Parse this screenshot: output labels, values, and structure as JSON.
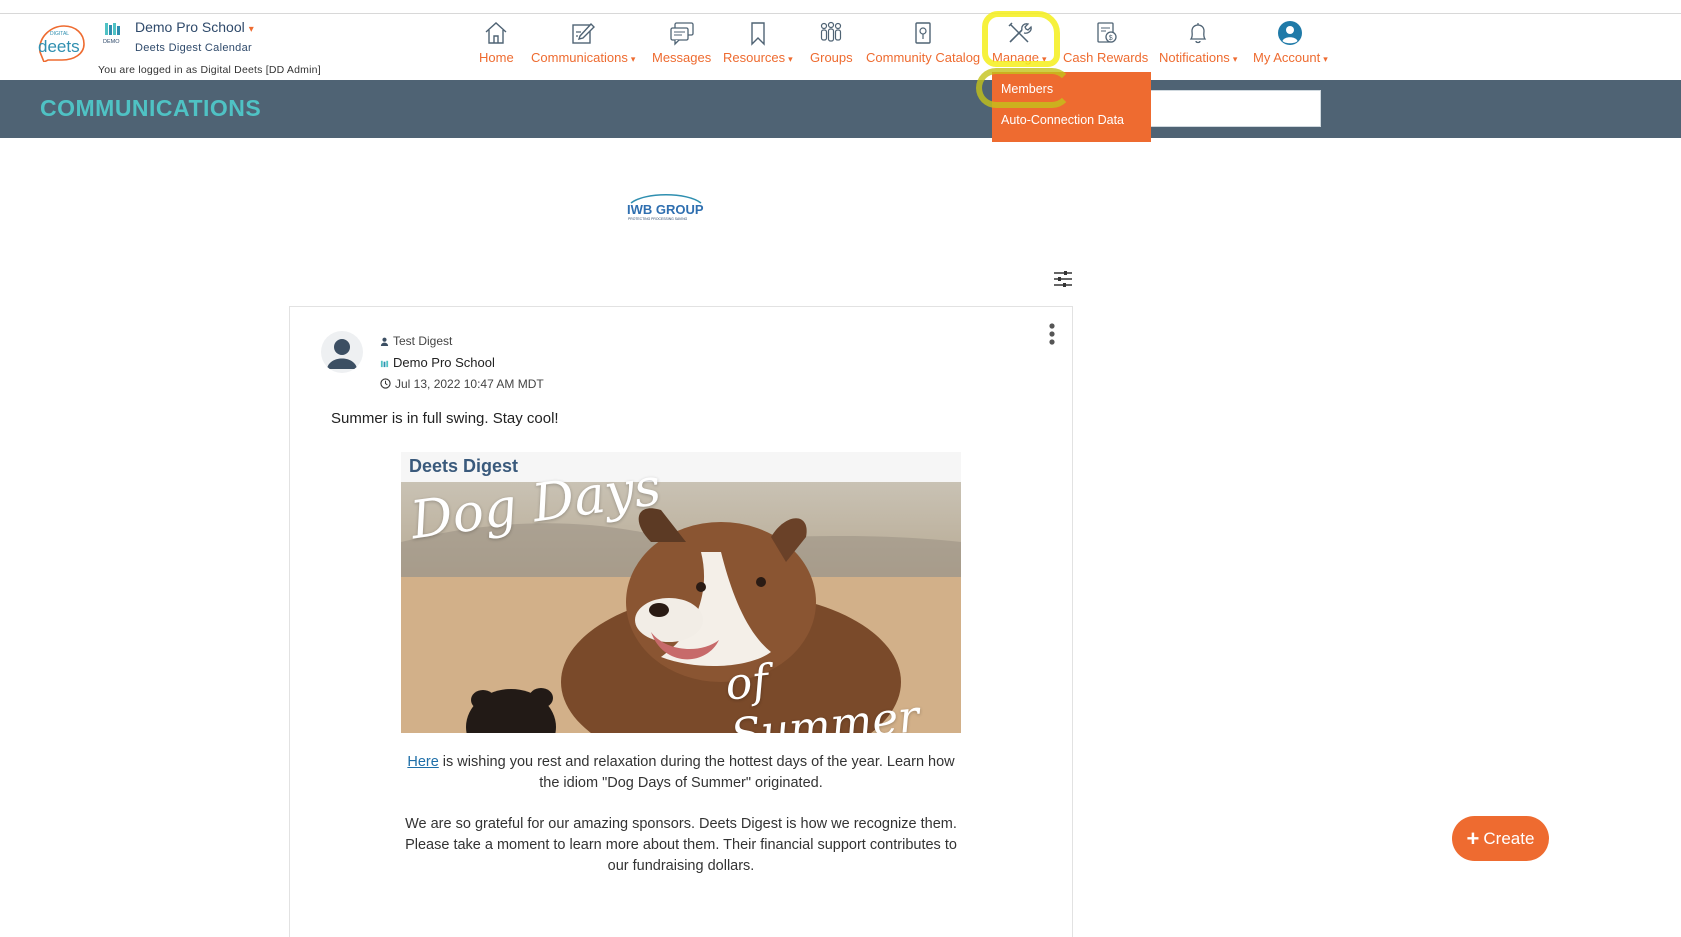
{
  "header": {
    "brand": "deets",
    "brand_small": "DIGITAL",
    "school_badge": "DEMO",
    "school_name": "Demo Pro School",
    "school_subtitle": "Deets Digest Calendar",
    "logged_in_text": "You are logged in as Digital Deets [DD Admin]"
  },
  "nav": {
    "home": "Home",
    "communications": "Communications",
    "messages": "Messages",
    "resources": "Resources",
    "groups": "Groups",
    "community_catalog": "Community Catalog",
    "manage": "Manage",
    "cash_rewards": "Cash Rewards",
    "notifications": "Notifications",
    "my_account": "My Account",
    "caret": "▾"
  },
  "manage_menu": {
    "items": [
      "Members",
      "Auto-Connection Data"
    ]
  },
  "page": {
    "title": "COMMUNICATIONS"
  },
  "sponsor": {
    "name": "IWB GROUP",
    "tagline": "PROTECTING PROCESSING SAVING"
  },
  "post": {
    "author": "Test Digest",
    "school": "Demo Pro School",
    "timestamp": "Jul 13, 2022 10:47 AM MDT",
    "text": "Summer is in full swing. Stay cool!",
    "image": {
      "brand": "Deets Digest",
      "script_line1": "Dog Days",
      "script_line2": "of Summer"
    },
    "para1_link": "Here",
    "para1_rest": " is wishing you rest and relaxation during the hottest days of the year. Learn how the idiom \"Dog Days of Summer\" originated.",
    "para2": "We are so grateful for our amazing sponsors. Deets Digest is how we recognize them. Please take a moment to learn more about them. Their financial support contributes to our fundraising dollars."
  },
  "create_button": {
    "plus": "+",
    "label": "Create"
  },
  "colors": {
    "accent": "#ee6b30",
    "band": "#4f6374",
    "title_teal": "#4fc2c4",
    "navy": "#2f4a6b",
    "highlight": "#f5ee1b"
  }
}
